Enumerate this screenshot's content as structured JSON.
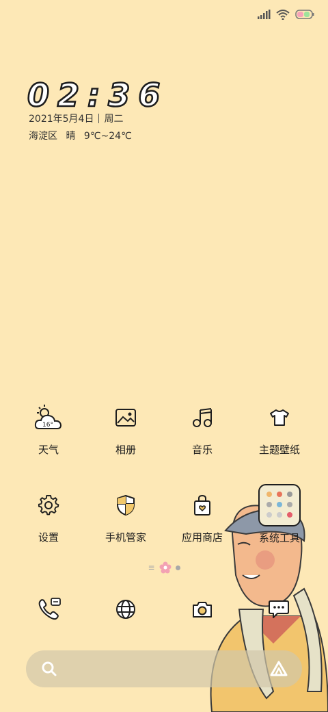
{
  "status_bar": {
    "icons": [
      "signal-icon",
      "wifi-icon",
      "battery-icon"
    ]
  },
  "lockscreen": {
    "time": "02:36",
    "date": "2021年5月4日",
    "weekday": "周二",
    "location": "海淀区",
    "condition": "晴",
    "temp_range": "9℃~24℃"
  },
  "apps_row1": [
    {
      "label": "天气",
      "icon": "weather-icon",
      "temp": "16°"
    },
    {
      "label": "相册",
      "icon": "gallery-icon"
    },
    {
      "label": "音乐",
      "icon": "music-icon"
    },
    {
      "label": "主题壁纸",
      "icon": "theme-icon"
    }
  ],
  "apps_row2": [
    {
      "label": "设置",
      "icon": "settings-icon"
    },
    {
      "label": "手机管家",
      "icon": "security-icon"
    },
    {
      "label": "应用商店",
      "icon": "store-icon"
    },
    {
      "label": "系统工具",
      "icon": "folder-icon"
    }
  ],
  "dock": [
    {
      "icon": "phone-icon"
    },
    {
      "icon": "browser-icon"
    },
    {
      "icon": "camera-icon"
    },
    {
      "icon": "messages-icon"
    }
  ],
  "colors": {
    "background": "#fde8b6",
    "icon_stroke": "#1e1e1e"
  }
}
